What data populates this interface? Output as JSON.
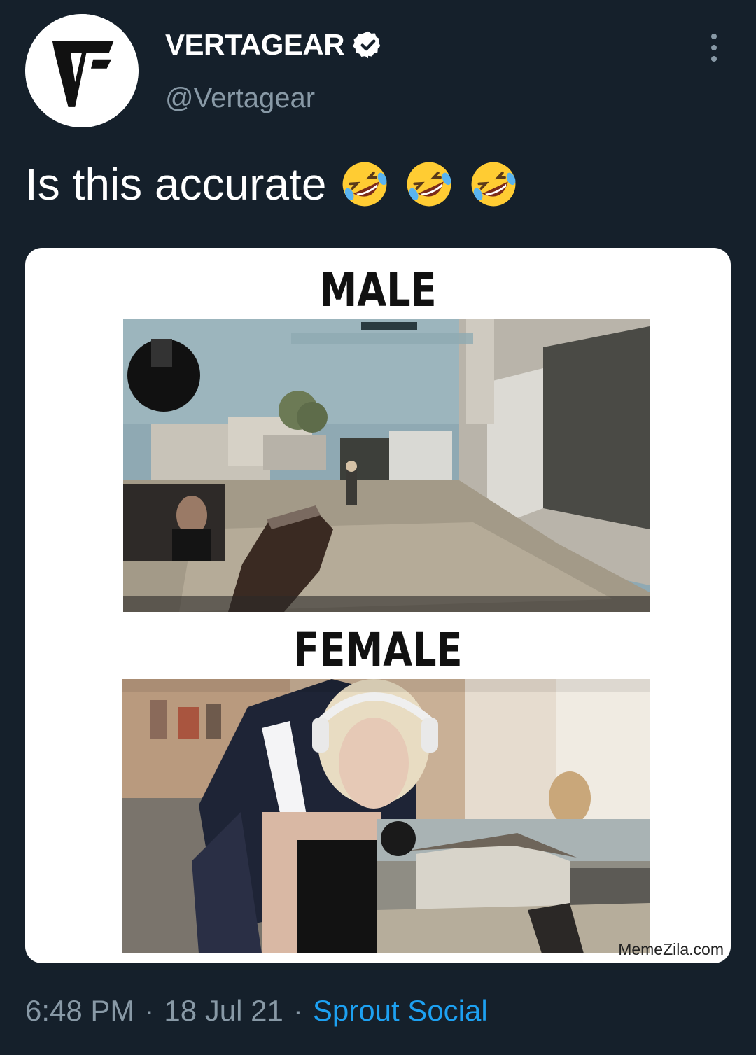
{
  "account": {
    "display_name": "VERTAGEAR",
    "handle": "@Vertagear"
  },
  "tweet": {
    "text": "Is this accurate",
    "emojis": [
      "rofl-emoji",
      "rofl-emoji",
      "rofl-emoji"
    ]
  },
  "media": {
    "label_top": "MALE",
    "label_bottom": "FEMALE",
    "watermark": "MemeZila.com"
  },
  "meta": {
    "time": "6:48 PM",
    "date": "18 Jul 21",
    "separator": "·",
    "source": "Sprout Social"
  },
  "colors": {
    "background": "#15202b",
    "secondary_text": "#8899a6",
    "link": "#1da1f2",
    "verified_badge": "#ffffff"
  }
}
